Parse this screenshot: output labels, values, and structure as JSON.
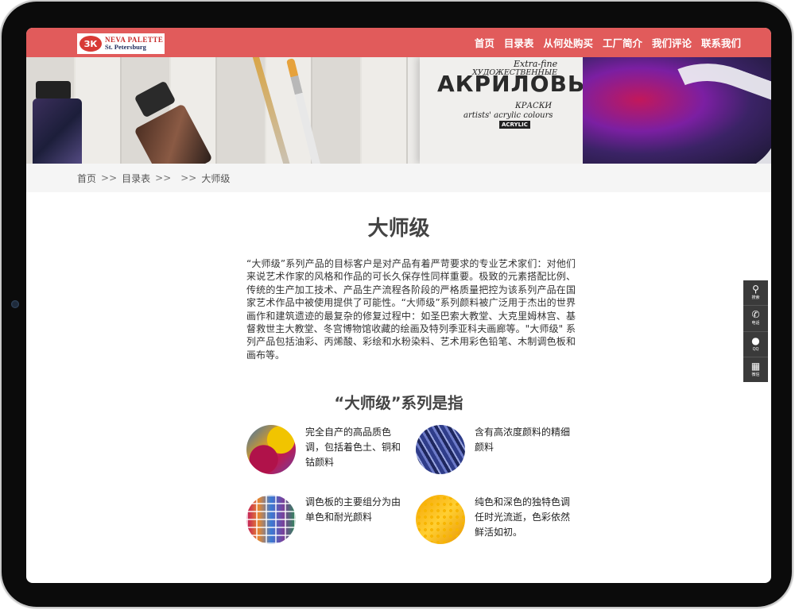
{
  "logo": {
    "mark": "ЗК",
    "line1": "NEVA PALETTE",
    "line2": "St. Petersburg"
  },
  "nav": {
    "items": [
      {
        "label": "首页"
      },
      {
        "label": "目录表"
      },
      {
        "label": "从何处购买"
      },
      {
        "label": "工厂简介"
      },
      {
        "label": "我们评论"
      },
      {
        "label": "联系我们"
      }
    ]
  },
  "banner": {
    "extra_fine": "Extra-fine",
    "line1": "ХУДОЖЕСТВЕННЫЕ",
    "line2": "АКРИЛОВЫЕ",
    "line3": "КРАСКИ",
    "line4": "artists' acrylic colours",
    "tag": "ACRYLIC"
  },
  "breadcrumb": {
    "home": "首页",
    "sep": ">>",
    "catalog": "目录表",
    "current": "大师级"
  },
  "main": {
    "title": "大师级",
    "intro": "“大师级”系列产品的目标客户是对产品有着严苛要求的专业艺术家们：对他们来说艺术作家的风格和作品的可长久保存性同样重要。极致的元素搭配比例、传统的生产加工技术、产品生产流程各阶段的严格质量把控为该系列产品在国家艺术作品中被使用提供了可能性。“大师级”系列颜料被广泛用于杰出的世界画作和建筑遗迹的最复杂的修复过程中：如圣巴索大教堂、大克里姆林宫、基督救世主大教堂、冬宫博物馆收藏的绘画及特列季亚科夫画廊等。\"大师级\" 系列产品包括油彩、丙烯酸、彩绘和水粉染料、艺术用彩色铅笔、木制调色板和画布等。",
    "subtitle": "“大师级”系列是指",
    "features": [
      {
        "text": "完全自产的高品质色调，包括着色土、铜和钴颜料"
      },
      {
        "text": "含有高浓度颜料的精细颜料"
      },
      {
        "text": "调色板的主要组分为由单色和耐光颜料"
      },
      {
        "text": "纯色和深色的独特色调任时光流逝，色彩依然鲜活如初。"
      }
    ]
  },
  "sidetools": [
    {
      "icon": "search-icon",
      "label": "搜索"
    },
    {
      "icon": "phone-icon",
      "label": "电话"
    },
    {
      "icon": "qq-icon",
      "label": "QQ"
    },
    {
      "icon": "qrcode-icon",
      "label": "微信"
    }
  ]
}
